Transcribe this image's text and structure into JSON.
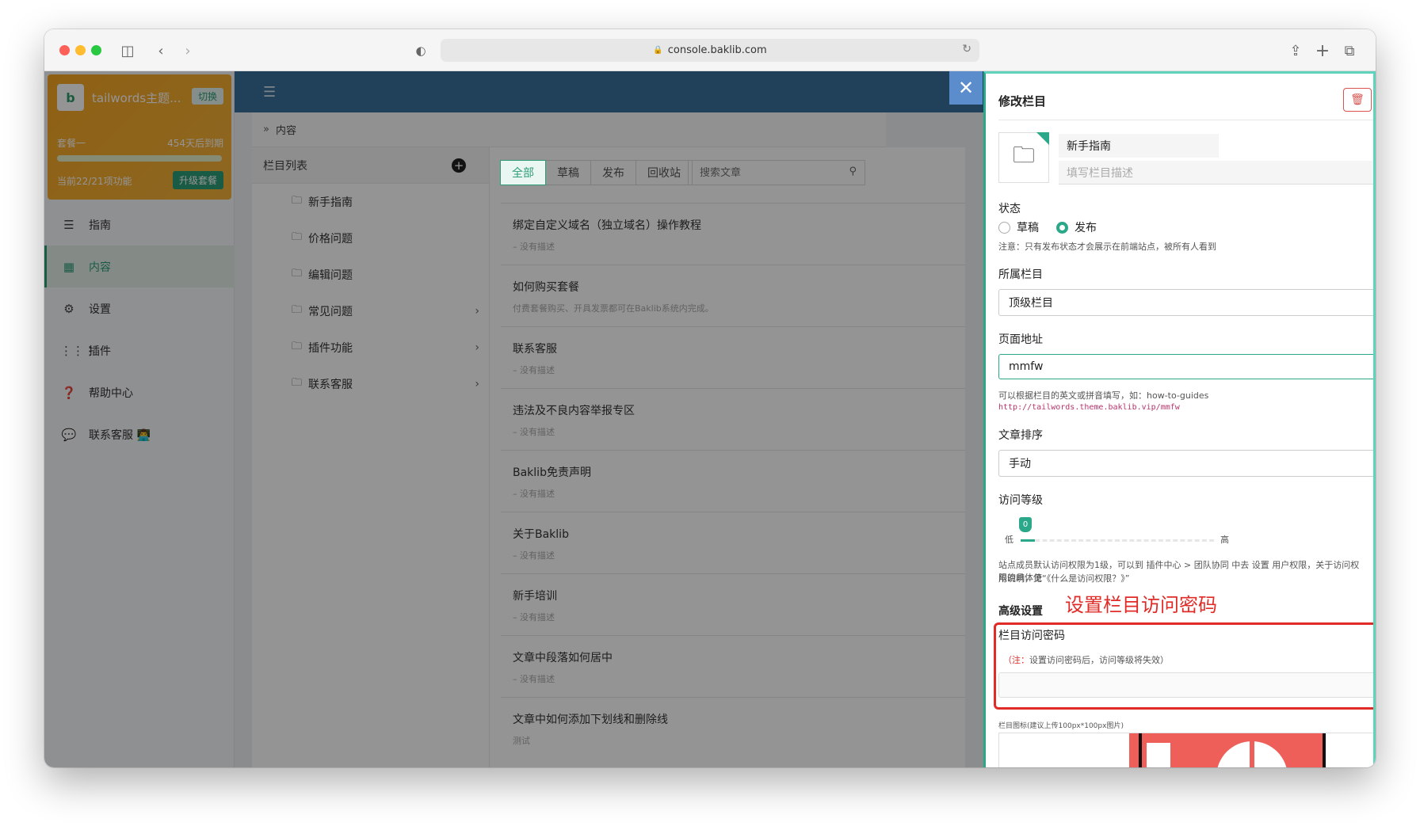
{
  "browser": {
    "url": "console.baklib.com"
  },
  "team": {
    "logo_text": "b",
    "name": "tailwords主题...",
    "switch_label": "切换",
    "plan_name": "套餐一",
    "plan_expiry": "454天后到期",
    "plan_usage": "当前22/21项功能",
    "upgrade_label": "升级套餐",
    "usage_fraction": 1.0
  },
  "sidebar": {
    "items": [
      {
        "label": "指南",
        "icon": "signpost-icon"
      },
      {
        "label": "内容",
        "icon": "grid-icon"
      },
      {
        "label": "设置",
        "icon": "gear-icon"
      },
      {
        "label": "插件",
        "icon": "apps-icon"
      },
      {
        "label": "帮助中心",
        "icon": "question-icon"
      },
      {
        "label": "联系客服 👨‍💻",
        "icon": "chat-icon"
      }
    ]
  },
  "breadcrumb": {
    "label": "内容"
  },
  "columns": {
    "header": "栏目列表",
    "items": [
      {
        "label": "新手指南"
      },
      {
        "label": "价格问题"
      },
      {
        "label": "编辑问题"
      },
      {
        "label": "常见问题"
      },
      {
        "label": "插件功能"
      },
      {
        "label": "联系客服"
      }
    ]
  },
  "articles": {
    "tabs": [
      {
        "label": "全部"
      },
      {
        "label": "草稿"
      },
      {
        "label": "发布"
      },
      {
        "label": "回收站"
      }
    ],
    "search_placeholder": "搜索文章",
    "items": [
      {
        "title": "绑定自定义域名（独立域名）操作教程",
        "desc": "– 没有描述"
      },
      {
        "title": "如何购买套餐",
        "desc": "付费套餐购买、开具发票都可在Baklib系统内完成。"
      },
      {
        "title": "联系客服",
        "desc": "– 没有描述"
      },
      {
        "title": "违法及不良内容举报专区",
        "desc": "– 没有描述"
      },
      {
        "title": "Baklib免责声明",
        "desc": "– 没有描述"
      },
      {
        "title": "关于Baklib",
        "desc": "– 没有描述"
      },
      {
        "title": "新手培训",
        "desc": "– 没有描述"
      },
      {
        "title": "文章中段落如何居中",
        "desc": "– 没有描述"
      },
      {
        "title": "文章中如何添加下划线和删除线",
        "desc": "测试"
      }
    ]
  },
  "drawer": {
    "title": "修改栏目",
    "column_name": "新手指南",
    "desc_placeholder": "填写栏目描述",
    "status_label": "状态",
    "status_options": [
      "草稿",
      "发布"
    ],
    "status_selected": "发布",
    "status_hint": "注意：只有发布状态才会展示在前端站点，被所有人看到",
    "parent_label": "所属栏目",
    "parent_value": "顶级栏目",
    "url_label": "页面地址",
    "url_value": "mmfw",
    "url_hint": "可以根据栏目的英文或拼音填写，如：how-to-guides",
    "url_full": "http://tailwords.theme.baklib.vip/mmfw",
    "sort_label": "文章排序",
    "sort_value": "手动",
    "access_label": "访问等级",
    "access_low": "低",
    "access_high": "高",
    "access_value": "0",
    "access_hint_1": "站点成员默认访问权限为1级，可以到 插件中心 > 团队协同 中去 设置 用户权限，关于访问权限的具体使",
    "access_hint_2": "用说明，见“《什么是访问权限？》”",
    "advanced_label": "高级设置",
    "annotation": "设置栏目访问密码",
    "password_label": "栏目访问密码",
    "password_note_prefix": "（注：",
    "password_note_body": "设置访问密码后，访问等级将失效）",
    "icon_label": "栏目图标(建议上传100px*100px图片)"
  },
  "colors": {
    "accent": "#2aa889",
    "annotation_red": "#e02b27",
    "topbar": "#3a6f9b",
    "team_card": "#f6a623"
  }
}
